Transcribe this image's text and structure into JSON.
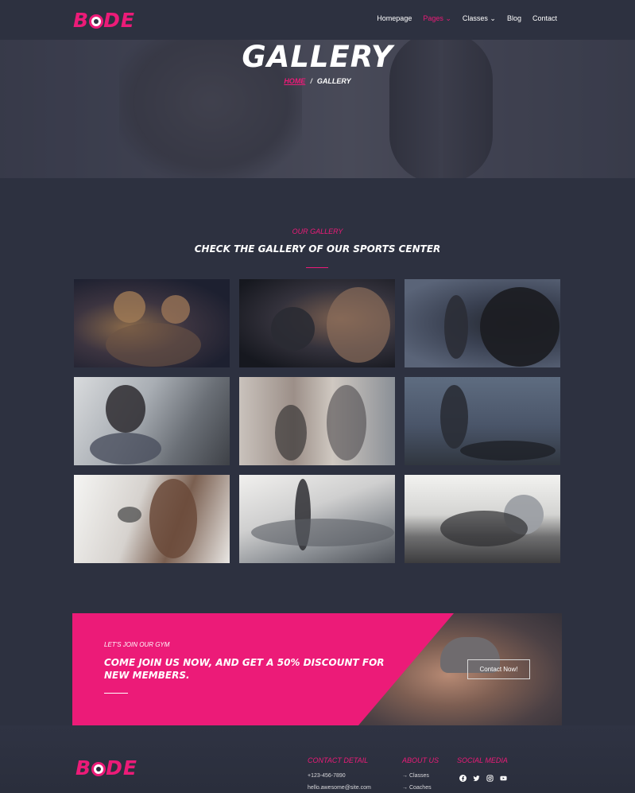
{
  "brand": {
    "logo_pre": "B",
    "logo_post": "DE"
  },
  "nav": {
    "items": [
      {
        "label": "Homepage"
      },
      {
        "label": "Pages ⌄"
      },
      {
        "label": "Classes ⌄"
      },
      {
        "label": "Blog"
      },
      {
        "label": "Contact"
      }
    ]
  },
  "hero": {
    "title": "GALLERY",
    "breadcrumb_home": "HOME",
    "breadcrumb_sep": "/",
    "breadcrumb_current": "GALLERY"
  },
  "gallery": {
    "kicker": "OUR GALLERY",
    "title": "CHECK THE GALLERY OF OUR SPORTS CENTER"
  },
  "cta": {
    "kicker": "LET'S JOIN OUR GYM",
    "title": "COME JOIN US NOW, AND GET A 50% DISCOUNT FOR NEW MEMBERS.",
    "button": "Contact Now!"
  },
  "footer": {
    "contact_heading": "CONTACT DETAIL",
    "phone": "+123-456-7890",
    "email": "hello.awesome@site.com",
    "about_heading": "ABOUT US",
    "about_items": [
      "Classes",
      "Coaches"
    ],
    "social_heading": "SOCIAL MEDIA",
    "social_icons": [
      "facebook-icon",
      "twitter-icon",
      "instagram-icon",
      "youtube-icon"
    ]
  },
  "colors": {
    "accent": "#ec1b78",
    "background": "#2d3140"
  }
}
